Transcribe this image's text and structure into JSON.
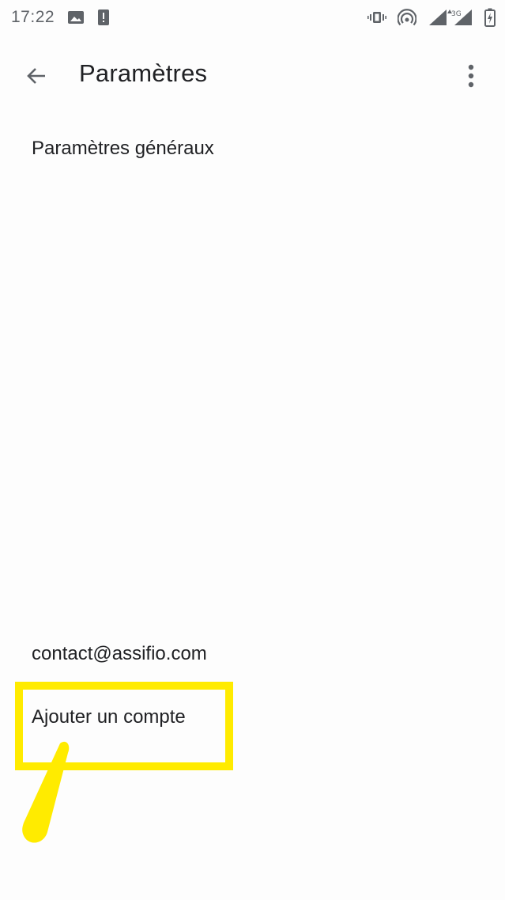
{
  "status_bar": {
    "time": "17:22",
    "left_icons": [
      "image-notification-icon",
      "alert-notification-icon"
    ],
    "right_icons": [
      "vibrate-icon",
      "hotspot-icon",
      "signal-icon",
      "network-3g-icon",
      "battery-charging-icon"
    ],
    "network_type": "3G"
  },
  "app_bar": {
    "title": "Paramètres",
    "back_icon": "arrow-back-icon",
    "menu_icon": "more-vert-icon"
  },
  "settings": {
    "general": "Paramètres généraux",
    "account": "contact@assifio.com",
    "add_account": "Ajouter un compte"
  },
  "annotation": {
    "color": "#ffeb00"
  }
}
